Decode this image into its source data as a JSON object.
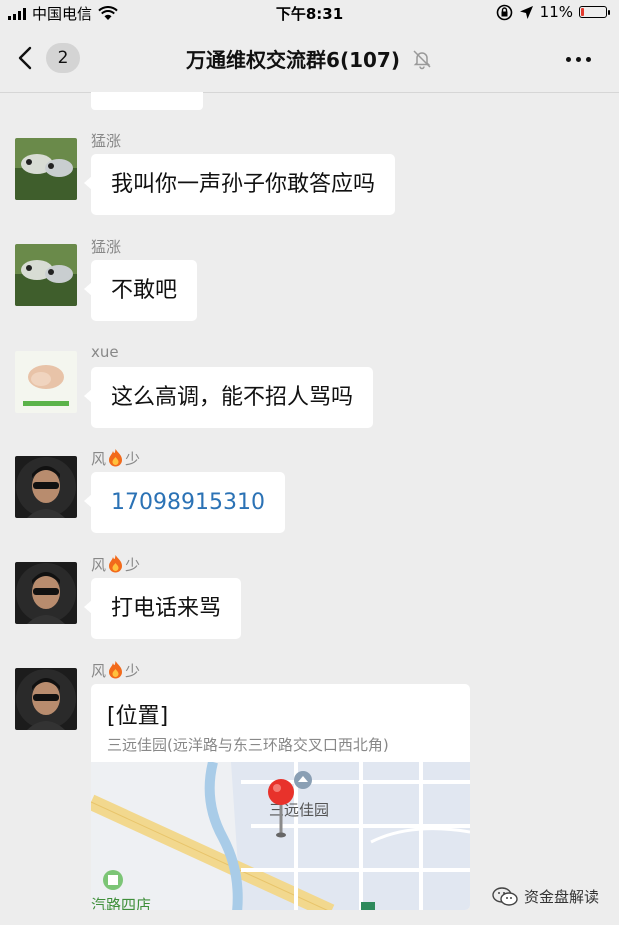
{
  "status_bar": {
    "carrier": "中国电信",
    "time": "下午8:31",
    "battery_percent": "11%",
    "battery_level": 0.11
  },
  "nav": {
    "unread_count": "2",
    "title": "万通维权交流群6(107)"
  },
  "messages": [
    {
      "sender": "猛涨",
      "text": "我叫你一声孙子你敢答应吗"
    },
    {
      "sender": "猛涨",
      "text": "不敢吧"
    },
    {
      "sender": "xue",
      "text": "这么高调，能不招人骂吗"
    },
    {
      "sender_a": "风",
      "sender_b": "少",
      "text": "17098915310",
      "type": "phone"
    },
    {
      "sender_a": "风",
      "sender_b": "少",
      "text": "打电话来骂"
    },
    {
      "sender_a": "风",
      "sender_b": "少",
      "type": "location",
      "title": "[位置]",
      "address": "三远佳园(远洋路与东三环路交叉口西北角)",
      "map_label": "三远佳园",
      "map_label_2": "汽路四店"
    }
  ],
  "watermark": "资金盘解读",
  "colors": {
    "link": "#2b72b5",
    "pin": "#e8322b",
    "battery_low": "#e23a2e"
  }
}
